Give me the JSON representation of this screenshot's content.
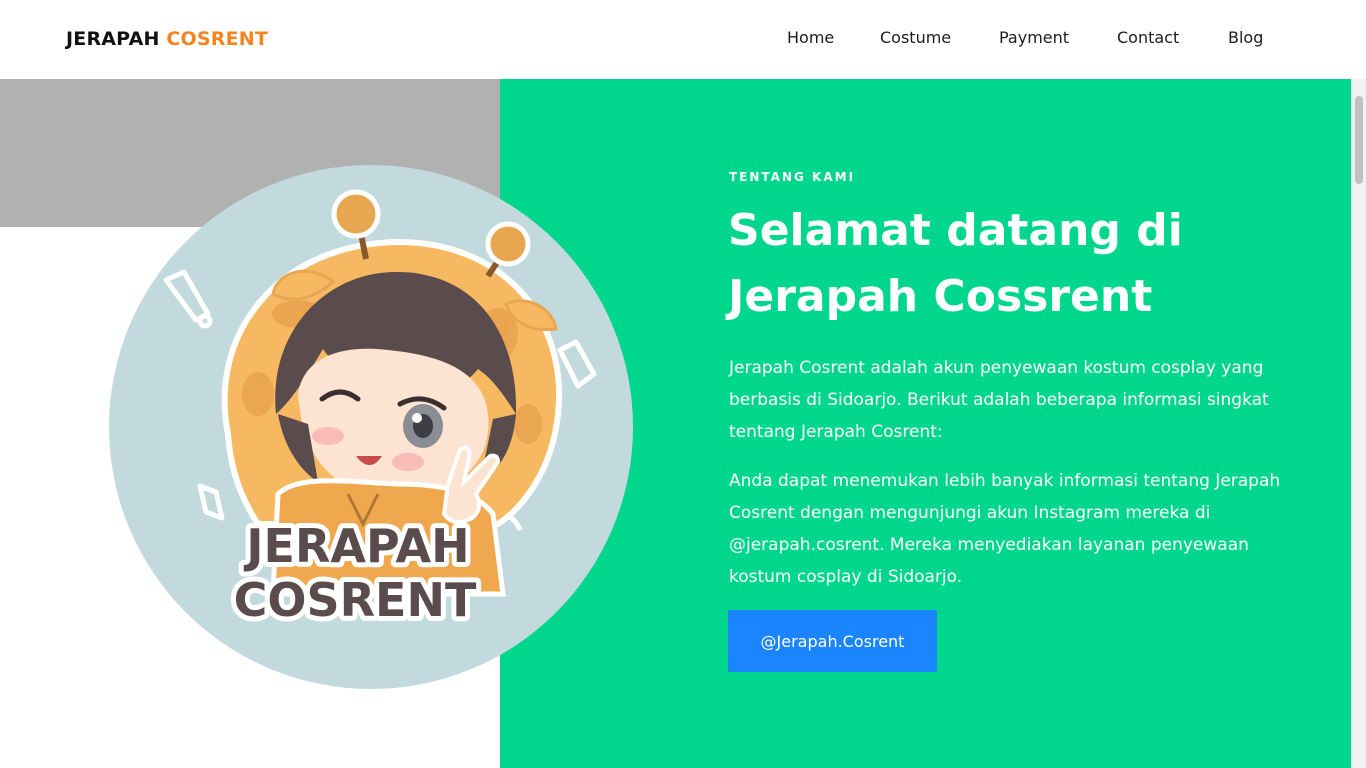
{
  "header": {
    "brand_part1": "JERAPAH",
    "brand_part2": "COSRENT",
    "brand_colors": {
      "primary": "#111111",
      "accent": "#f5841f"
    },
    "nav": [
      {
        "label": "Home"
      },
      {
        "label": "Costume"
      },
      {
        "label": "Payment"
      },
      {
        "label": "Contact"
      },
      {
        "label": "Blog"
      }
    ]
  },
  "about": {
    "eyebrow": "TENTANG KAMI",
    "headline": "Selamat datang di Jerapah Cossrent",
    "paragraph_1": "Jerapah Cosrent adalah akun penyewaan kostum cosplay yang berbasis di Sidoarjo. Berikut adalah beberapa informasi singkat tentang Jerapah Cosrent:",
    "paragraph_2": "Anda dapat menemukan lebih banyak informasi tentang Jerapah Cosrent dengan mengunjungi akun Instagram mereka di @jerapah.cosrent. Mereka menyediakan layanan penyewaan kostum cosplay di Sidoarjo.",
    "button_label": "@Jerapah.Cosrent"
  },
  "logo": {
    "text_line_1": "JERAPAH",
    "text_line_2": "COSRENT",
    "icon": "giraffe-hood-chibi-logo"
  },
  "colors": {
    "panel_green": "#00d68c",
    "band_gray": "#b1b1b1",
    "button_blue": "#1a85ff",
    "logo_circle": "#c2dadd"
  }
}
